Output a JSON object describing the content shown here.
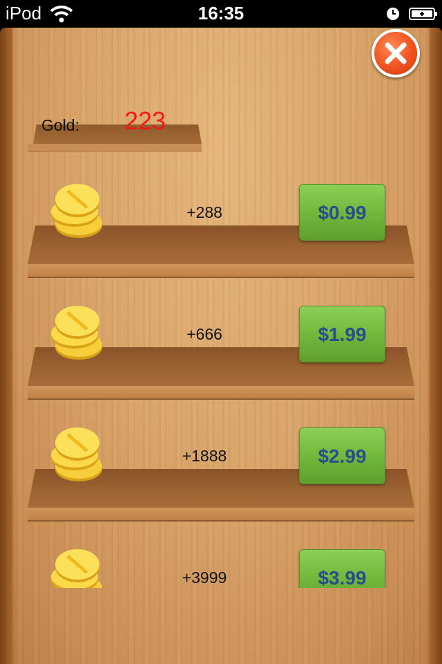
{
  "status_bar": {
    "carrier": "iPod",
    "time": "16:35",
    "icons": [
      "wifi-icon",
      "clock-icon",
      "battery-icon"
    ]
  },
  "close_button": {
    "icon": "close-icon"
  },
  "gold": {
    "label": "Gold:",
    "value": "223"
  },
  "products": [
    {
      "amount": "+288",
      "price": "$0.99",
      "icon": "coin-stack-icon"
    },
    {
      "amount": "+666",
      "price": "$1.99",
      "icon": "coin-stack-icon"
    },
    {
      "amount": "+1888",
      "price": "$2.99",
      "icon": "coin-stack-icon"
    },
    {
      "amount": "+3999",
      "price": "$3.99",
      "icon": "coin-stack-icon"
    }
  ],
  "colors": {
    "gold_value": "#ee1b10",
    "buy_button": "#74bb3f",
    "price_text": "#2b4d8a",
    "close_button": "#f0521f"
  }
}
